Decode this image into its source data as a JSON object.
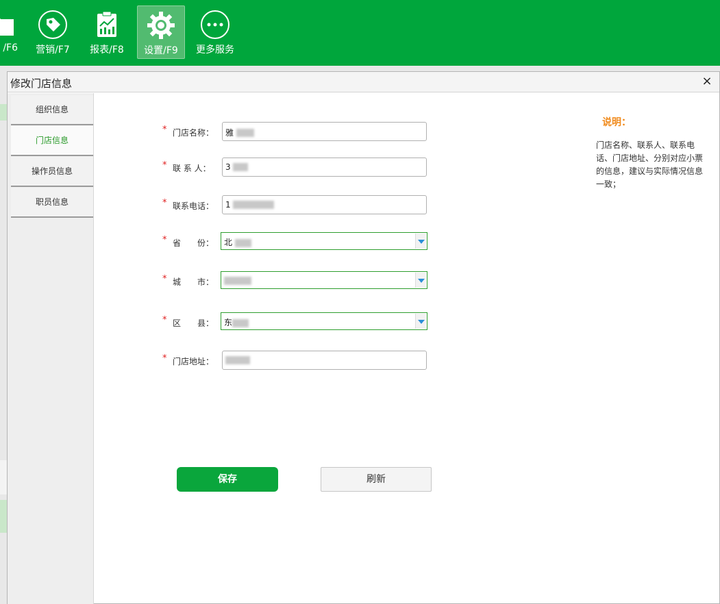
{
  "toolbar": {
    "items": [
      {
        "label": "/F6",
        "icon": "folder-icon"
      },
      {
        "label": "营销/F7",
        "icon": "tag-icon"
      },
      {
        "label": "报表/F8",
        "icon": "report-icon"
      },
      {
        "label": "设置/F9",
        "icon": "gear-icon"
      },
      {
        "label": "更多服务",
        "icon": "more-icon"
      }
    ]
  },
  "dialog": {
    "title": "修改门店信息",
    "close": "×"
  },
  "sidebar": {
    "items": [
      {
        "label": "组织信息"
      },
      {
        "label": "门店信息"
      },
      {
        "label": "操作员信息"
      },
      {
        "label": "职员信息"
      }
    ],
    "selected": "门店信息"
  },
  "form": {
    "required_mark": "*",
    "store_name": {
      "label": "门店名称：",
      "value": "雅"
    },
    "contact": {
      "label": "联 系 人：",
      "value": "3"
    },
    "phone": {
      "label": "联系电话：",
      "value": "1"
    },
    "province": {
      "label": "省　　份：",
      "value": "北"
    },
    "city": {
      "label": "城　　市：",
      "value": ""
    },
    "district": {
      "label": "区　　县：",
      "value": "东"
    },
    "address": {
      "label": "门店地址：",
      "value": ""
    }
  },
  "buttons": {
    "save": "保存",
    "refresh": "刷新"
  },
  "note": {
    "title": "说明：",
    "text": "门店名称、联系人、联系电话、门店地址、分别对应小票的信息，建议与实际情况信息一致；"
  },
  "colors": {
    "brand_green": "#00a63c",
    "required_red": "#e02020",
    "note_orange": "#f08a1c"
  }
}
